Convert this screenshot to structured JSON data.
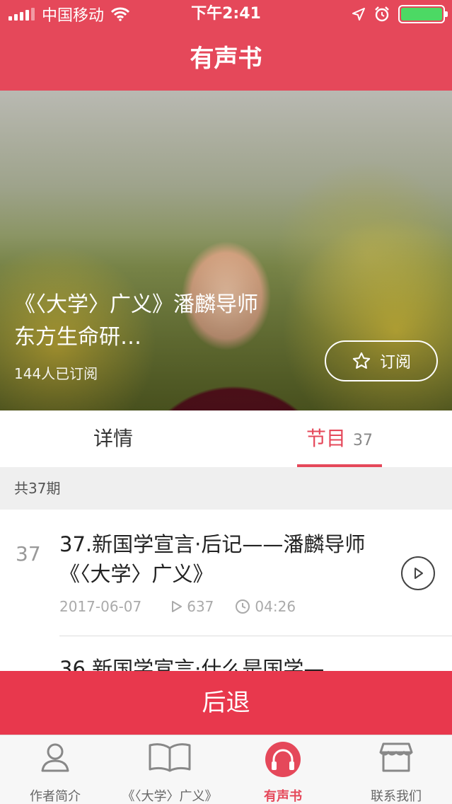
{
  "status_bar": {
    "carrier": "中国移动",
    "time": "下午2:41"
  },
  "nav": {
    "title": "有声书"
  },
  "hero": {
    "title": "《〈大学〉广义》潘麟导师 东方生命研…",
    "subscribers": "144人已订阅",
    "subscribe_label": "订阅"
  },
  "tabs": {
    "detail": "详情",
    "episodes": "节目",
    "episodes_count": "37"
  },
  "list": {
    "total_label": "共37期",
    "episodes": [
      {
        "number": "37",
        "title": "37.新国学宣言·后记——潘麟导师《〈大学〉广义》",
        "date": "2017-06-07",
        "plays": "637",
        "duration": "04:26"
      },
      {
        "title": "36.新国学宣言·什么是国学—"
      }
    ]
  },
  "back_button": {
    "label": "后退"
  },
  "bottom_tabs": [
    {
      "label": "作者简介",
      "icon": "person-icon"
    },
    {
      "label": "《〈大学〉广义》",
      "icon": "book-icon"
    },
    {
      "label": "有声书",
      "icon": "headphones-icon"
    },
    {
      "label": "联系我们",
      "icon": "store-icon"
    }
  ],
  "colors": {
    "brand_red": "#e5485a",
    "back_button_red": "#e8384d",
    "battery_green": "#4cd964"
  }
}
